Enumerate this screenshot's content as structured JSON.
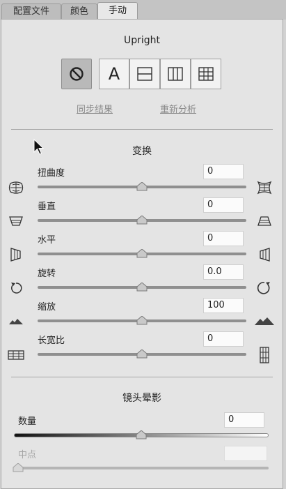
{
  "tabs": [
    {
      "label": "配置文件"
    },
    {
      "label": "颜色"
    },
    {
      "label": "手动"
    }
  ],
  "upright": {
    "title": "Upright",
    "buttons": [
      "off-icon",
      "auto-icon",
      "level-icon",
      "vertical-icon",
      "full-icon"
    ],
    "auto_label": "A",
    "sync_link": "同步结果",
    "reanalyze_link": "重新分析"
  },
  "transform": {
    "title": "变换",
    "rows": [
      {
        "label": "扭曲度",
        "value": "0",
        "slider_fraction": 0.5,
        "left_icon": "distortion-barrel-icon",
        "right_icon": "distortion-pincushion-icon"
      },
      {
        "label": "垂直",
        "value": "0",
        "slider_fraction": 0.5,
        "left_icon": "vertical-keystone-down-icon",
        "right_icon": "vertical-keystone-up-icon"
      },
      {
        "label": "水平",
        "value": "0",
        "slider_fraction": 0.5,
        "left_icon": "horizontal-keystone-left-icon",
        "right_icon": "horizontal-keystone-right-icon"
      },
      {
        "label": "旋转",
        "value": "0.0",
        "slider_fraction": 0.5,
        "left_icon": "rotate-ccw-icon",
        "right_icon": "rotate-cw-icon"
      },
      {
        "label": "缩放",
        "value": "100",
        "slider_fraction": 0.5,
        "left_icon": "scale-small-icon",
        "right_icon": "scale-large-icon"
      },
      {
        "label": "长宽比",
        "value": "0",
        "slider_fraction": 0.5,
        "left_icon": "aspect-wide-icon",
        "right_icon": "aspect-tall-icon"
      }
    ]
  },
  "vignette": {
    "title": "镜头晕影",
    "amount_label": "数量",
    "amount_value": "0",
    "amount_fraction": 0.5,
    "midpoint_label": "中点",
    "midpoint_value": "",
    "midpoint_fraction": 0.0
  }
}
